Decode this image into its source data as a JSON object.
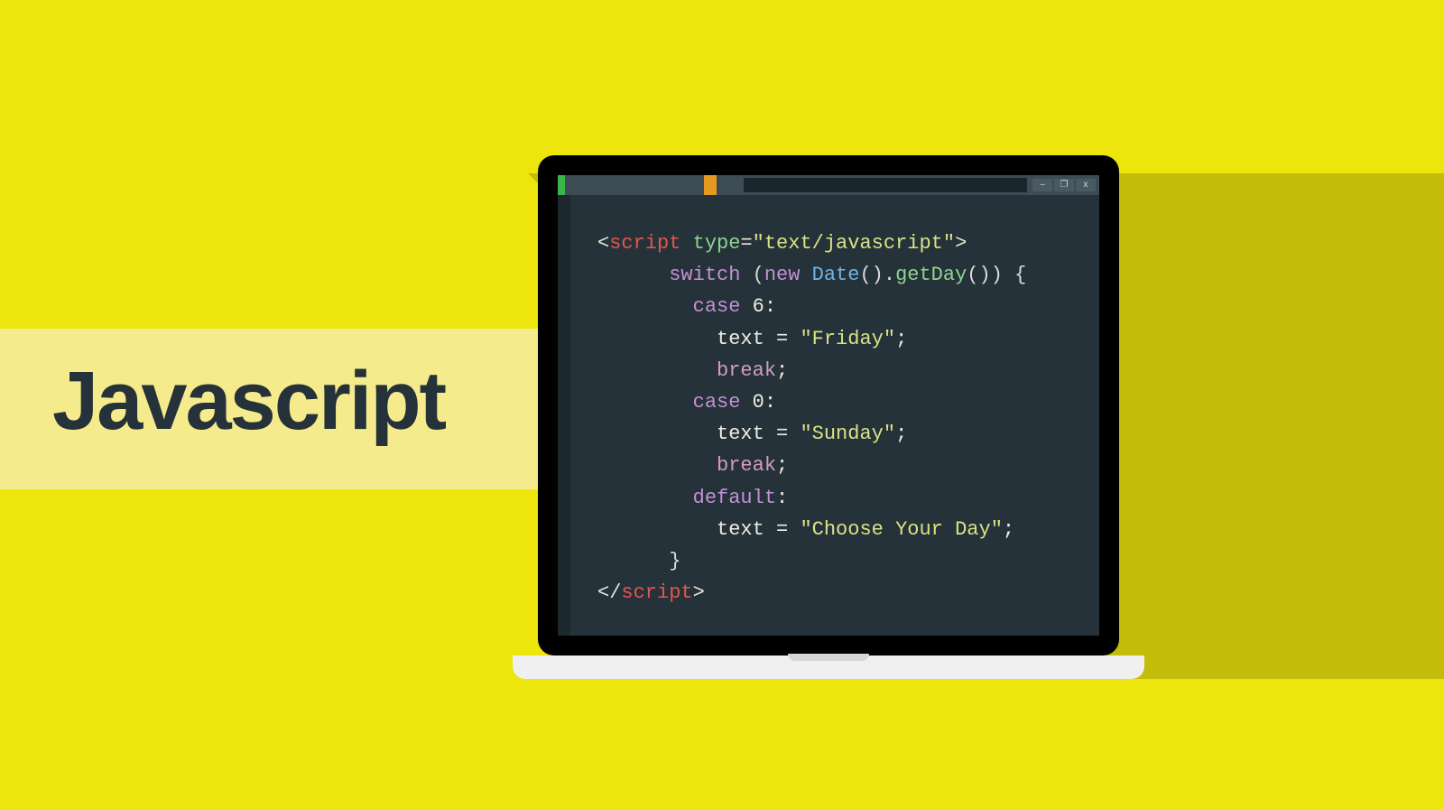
{
  "title": "Javascript",
  "window_controls": {
    "minimize": "–",
    "maximize": "❐",
    "close": "x"
  },
  "code": {
    "l1_open": "<",
    "l1_script": "script",
    "l1_sp_type": " type",
    "l1_eq": "=",
    "l1_typeval": "\"text/javascript\"",
    "l1_close": ">",
    "l2_switch": "switch ",
    "l2_open": "(",
    "l2_new": "new ",
    "l2_date": "Date",
    "l2_paren1": "().",
    "l2_getday": "getDay",
    "l2_paren2": "()) {",
    "l3_case": "case ",
    "l3_num": "6",
    "l3_colon": ":",
    "l4_text": "text ",
    "l4_eq": "= ",
    "l4_str": "\"Friday\"",
    "l4_semi": ";",
    "l5_break": "break",
    "l5_semi": ";",
    "l6_case": "case ",
    "l6_num": "0",
    "l6_colon": ":",
    "l7_text": "text ",
    "l7_eq": "= ",
    "l7_str": "\"Sunday\"",
    "l7_semi": ";",
    "l8_break": "break",
    "l8_semi": ";",
    "l9_default": "default",
    "l9_colon": ":",
    "l10_text": "text ",
    "l10_eq": "= ",
    "l10_str": "\"Choose Your Day\"",
    "l10_semi": ";",
    "l11_brace": "}",
    "l12_open": "</",
    "l12_script": "script",
    "l12_close": ">"
  }
}
